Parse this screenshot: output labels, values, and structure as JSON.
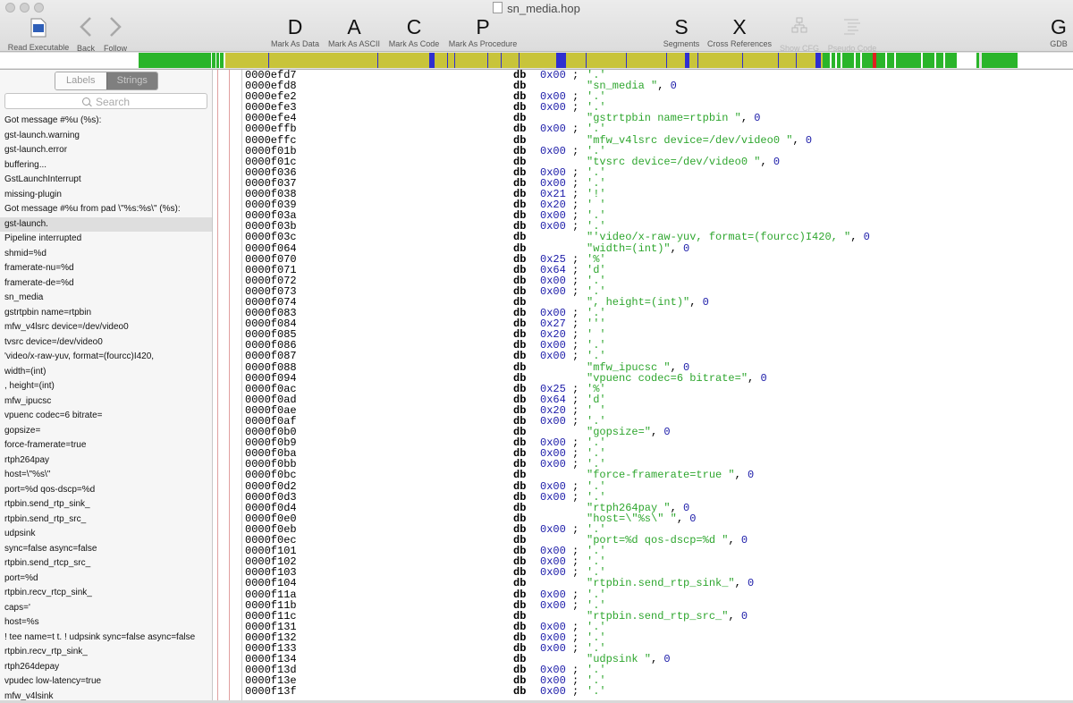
{
  "window": {
    "title": "sn_media.hop"
  },
  "toolbar": {
    "read_executable": "Read Executable",
    "back": "Back",
    "follow": "Follow",
    "mark_data": {
      "glyph": "D",
      "label": "Mark As Data"
    },
    "mark_ascii": {
      "glyph": "A",
      "label": "Mark As ASCII"
    },
    "mark_code": {
      "glyph": "C",
      "label": "Mark As Code"
    },
    "mark_proc": {
      "glyph": "P",
      "label": "Mark As Procedure"
    },
    "segments": {
      "glyph": "S",
      "label": "Segments"
    },
    "xrefs": {
      "glyph": "X",
      "label": "Cross References"
    },
    "show_cfg": "Show CFG",
    "pseudo_code": "Pseudo Code",
    "gdb": {
      "glyph": "G",
      "label": "GDB"
    },
    "icons": {
      "read_executable": "file-icon",
      "back": "chevron-left-icon",
      "follow": "chevron-right-icon",
      "show_cfg": "flowchart-icon",
      "pseudo_code": "code-lines-icon"
    }
  },
  "colors": {
    "code": "#2ab52a",
    "data": "#c8c43a",
    "procedure": "#2f2fd0",
    "cursor": "#e02020",
    "unexplored": "#ffffff"
  },
  "sidebar": {
    "tab_labels": "Labels",
    "tab_strings": "Strings",
    "active_tab": "Strings",
    "search_placeholder": "Search",
    "strings": [
      "Got message #%u (%s):",
      "gst-launch.warning",
      "gst-launch.error",
      "buffering...",
      "GstLaunchInterrupt",
      "missing-plugin",
      "Got message #%u from pad \\\"%s:%s\\\" (%s):",
      "gst-launch.",
      "Pipeline interrupted",
      "shmid=%d",
      "framerate-nu=%d",
      "framerate-de=%d",
      "sn_media",
      "gstrtpbin name=rtpbin",
      "mfw_v4lsrc device=/dev/video0",
      "tvsrc device=/dev/video0",
      "'video/x-raw-yuv, format=(fourcc)I420,",
      "width=(int)",
      ", height=(int)",
      "mfw_ipucsc",
      "vpuenc codec=6 bitrate=",
      "gopsize=",
      "force-framerate=true",
      "rtph264pay",
      "host=\\\"%s\\\"",
      "port=%d qos-dscp=%d",
      "rtpbin.send_rtp_sink_",
      "rtpbin.send_rtp_src_",
      "udpsink",
      "sync=false async=false",
      "rtpbin.send_rtcp_src_",
      "port=%d",
      "rtpbin.recv_rtcp_sink_",
      "caps='",
      "host=%s",
      "! tee name=t t. ! udpsink sync=false async=false",
      "rtpbin.recv_rtp_sink_",
      "rtph264depay",
      "vpudec low-latency=true",
      "mfw_v4lsink"
    ],
    "selected_index": 7
  },
  "listing": [
    {
      "a": "0000efd7",
      "m": "db",
      "h": "0x00",
      "c": "'.'"
    },
    {
      "a": "0000efd8",
      "m": "db",
      "s": "\"sn_media \"",
      "z": "0"
    },
    {
      "a": "0000efe2",
      "m": "db",
      "h": "0x00",
      "c": "'.'"
    },
    {
      "a": "0000efe3",
      "m": "db",
      "h": "0x00",
      "c": "'.'"
    },
    {
      "a": "0000efe4",
      "m": "db",
      "s": "\"gstrtpbin name=rtpbin \"",
      "z": "0"
    },
    {
      "a": "0000effb",
      "m": "db",
      "h": "0x00",
      "c": "'.'"
    },
    {
      "a": "0000effc",
      "m": "db",
      "s": "\"mfw_v4lsrc device=/dev/video0 \"",
      "z": "0"
    },
    {
      "a": "0000f01b",
      "m": "db",
      "h": "0x00",
      "c": "'.'"
    },
    {
      "a": "0000f01c",
      "m": "db",
      "s": "\"tvsrc device=/dev/video0 \"",
      "z": "0"
    },
    {
      "a": "0000f036",
      "m": "db",
      "h": "0x00",
      "c": "'.'"
    },
    {
      "a": "0000f037",
      "m": "db",
      "h": "0x00",
      "c": "'.'"
    },
    {
      "a": "0000f038",
      "m": "db",
      "h": "0x21",
      "c": "'!'"
    },
    {
      "a": "0000f039",
      "m": "db",
      "h": "0x20",
      "c": "' '"
    },
    {
      "a": "0000f03a",
      "m": "db",
      "h": "0x00",
      "c": "'.'"
    },
    {
      "a": "0000f03b",
      "m": "db",
      "h": "0x00",
      "c": "'.'"
    },
    {
      "a": "0000f03c",
      "m": "db",
      "s": "\"'video/x-raw-yuv, format=(fourcc)I420, \"",
      "z": "0"
    },
    {
      "a": "0000f064",
      "m": "db",
      "s": "\"width=(int)\"",
      "z": "0"
    },
    {
      "a": "0000f070",
      "m": "db",
      "h": "0x25",
      "c": "'%'"
    },
    {
      "a": "0000f071",
      "m": "db",
      "h": "0x64",
      "c": "'d'"
    },
    {
      "a": "0000f072",
      "m": "db",
      "h": "0x00",
      "c": "'.'"
    },
    {
      "a": "0000f073",
      "m": "db",
      "h": "0x00",
      "c": "'.'"
    },
    {
      "a": "0000f074",
      "m": "db",
      "s": "\", height=(int)\"",
      "z": "0"
    },
    {
      "a": "0000f083",
      "m": "db",
      "h": "0x00",
      "c": "'.'"
    },
    {
      "a": "0000f084",
      "m": "db",
      "h": "0x27",
      "c": "'''"
    },
    {
      "a": "0000f085",
      "m": "db",
      "h": "0x20",
      "c": "' '"
    },
    {
      "a": "0000f086",
      "m": "db",
      "h": "0x00",
      "c": "'.'"
    },
    {
      "a": "0000f087",
      "m": "db",
      "h": "0x00",
      "c": "'.'"
    },
    {
      "a": "0000f088",
      "m": "db",
      "s": "\"mfw_ipucsc \"",
      "z": "0"
    },
    {
      "a": "0000f094",
      "m": "db",
      "s": "\"vpuenc codec=6 bitrate=\"",
      "z": "0"
    },
    {
      "a": "0000f0ac",
      "m": "db",
      "h": "0x25",
      "c": "'%'"
    },
    {
      "a": "0000f0ad",
      "m": "db",
      "h": "0x64",
      "c": "'d'"
    },
    {
      "a": "0000f0ae",
      "m": "db",
      "h": "0x20",
      "c": "' '"
    },
    {
      "a": "0000f0af",
      "m": "db",
      "h": "0x00",
      "c": "'.'"
    },
    {
      "a": "0000f0b0",
      "m": "db",
      "s": "\"gopsize=\"",
      "z": "0"
    },
    {
      "a": "0000f0b9",
      "m": "db",
      "h": "0x00",
      "c": "'.'"
    },
    {
      "a": "0000f0ba",
      "m": "db",
      "h": "0x00",
      "c": "'.'"
    },
    {
      "a": "0000f0bb",
      "m": "db",
      "h": "0x00",
      "c": "'.'"
    },
    {
      "a": "0000f0bc",
      "m": "db",
      "s": "\"force-framerate=true \"",
      "z": "0"
    },
    {
      "a": "0000f0d2",
      "m": "db",
      "h": "0x00",
      "c": "'.'"
    },
    {
      "a": "0000f0d3",
      "m": "db",
      "h": "0x00",
      "c": "'.'"
    },
    {
      "a": "0000f0d4",
      "m": "db",
      "s": "\"rtph264pay \"",
      "z": "0"
    },
    {
      "a": "0000f0e0",
      "m": "db",
      "s": "\"host=\\\"%s\\\" \"",
      "z": "0"
    },
    {
      "a": "0000f0eb",
      "m": "db",
      "h": "0x00",
      "c": "'.'"
    },
    {
      "a": "0000f0ec",
      "m": "db",
      "s": "\"port=%d qos-dscp=%d \"",
      "z": "0"
    },
    {
      "a": "0000f101",
      "m": "db",
      "h": "0x00",
      "c": "'.'"
    },
    {
      "a": "0000f102",
      "m": "db",
      "h": "0x00",
      "c": "'.'"
    },
    {
      "a": "0000f103",
      "m": "db",
      "h": "0x00",
      "c": "'.'"
    },
    {
      "a": "0000f104",
      "m": "db",
      "s": "\"rtpbin.send_rtp_sink_\"",
      "z": "0"
    },
    {
      "a": "0000f11a",
      "m": "db",
      "h": "0x00",
      "c": "'.'"
    },
    {
      "a": "0000f11b",
      "m": "db",
      "h": "0x00",
      "c": "'.'"
    },
    {
      "a": "0000f11c",
      "m": "db",
      "s": "\"rtpbin.send_rtp_src_\"",
      "z": "0"
    },
    {
      "a": "0000f131",
      "m": "db",
      "h": "0x00",
      "c": "'.'"
    },
    {
      "a": "0000f132",
      "m": "db",
      "h": "0x00",
      "c": "'.'"
    },
    {
      "a": "0000f133",
      "m": "db",
      "h": "0x00",
      "c": "'.'"
    },
    {
      "a": "0000f134",
      "m": "db",
      "s": "\"udpsink \"",
      "z": "0"
    },
    {
      "a": "0000f13d",
      "m": "db",
      "h": "0x00",
      "c": "'.'"
    },
    {
      "a": "0000f13e",
      "m": "db",
      "h": "0x00",
      "c": "'.'"
    },
    {
      "a": "0000f13f",
      "m": "db",
      "h": "0x00",
      "c": "'.'"
    }
  ]
}
